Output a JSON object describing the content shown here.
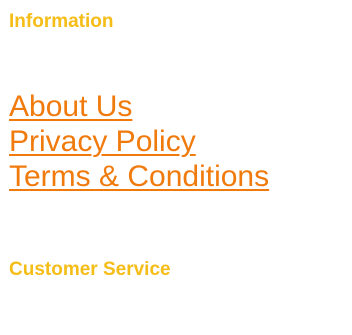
{
  "colors": {
    "heading": "#f5bd17",
    "link": "#f07a0c",
    "background": "#ffffff"
  },
  "information": {
    "heading": "Information",
    "links": [
      {
        "label": "About Us"
      },
      {
        "label": "Privacy Policy"
      },
      {
        "label": "Terms & Conditions"
      }
    ]
  },
  "customer_service": {
    "heading": "Customer Service"
  }
}
